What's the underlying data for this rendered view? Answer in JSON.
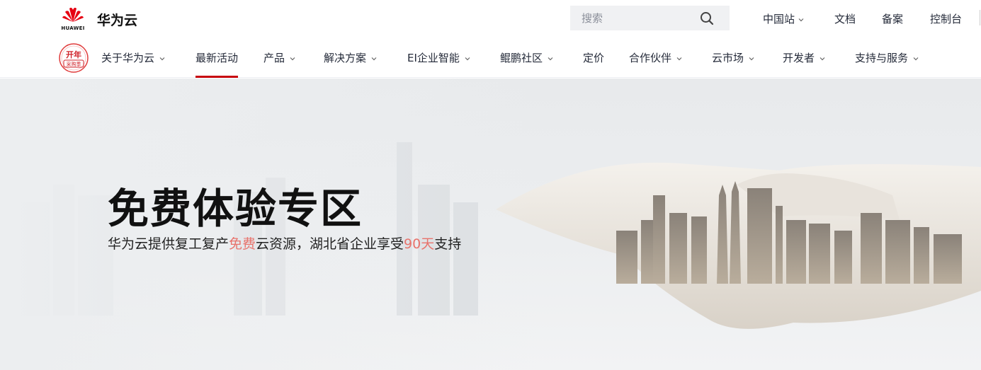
{
  "header": {
    "logo_text": "HUAWEI",
    "brand": "华为云",
    "search": {
      "placeholder": "搜索"
    },
    "links": [
      "中国站",
      "文档",
      "备案",
      "控制台"
    ]
  },
  "nav": {
    "promo_badge": {
      "line1": "开年",
      "line2": "采购季"
    },
    "items": [
      {
        "label": "关于华为云",
        "has_menu": true
      },
      {
        "label": "最新活动",
        "has_menu": false,
        "active": true
      },
      {
        "label": "产品",
        "has_menu": true
      },
      {
        "label": "解决方案",
        "has_menu": true
      },
      {
        "label": "EI企业智能",
        "has_menu": true
      },
      {
        "label": "鲲鹏社区",
        "has_menu": true
      },
      {
        "label": "定价",
        "has_menu": false
      },
      {
        "label": "合作伙伴",
        "has_menu": true
      },
      {
        "label": "云市场",
        "has_menu": true
      },
      {
        "label": "开发者",
        "has_menu": true
      },
      {
        "label": "支持与服务",
        "has_menu": true
      }
    ]
  },
  "hero": {
    "title": "免费体验专区",
    "subtitle_parts": [
      "华为云提供复工复产",
      "免费",
      "云资源，湖北省企业享受",
      "90天",
      "支持"
    ]
  },
  "colors": {
    "accent": "#c7000b",
    "highlight": "#e8736c",
    "search_bg": "#f0f1f3"
  },
  "icons": {
    "search": "search-icon",
    "chevron": "chevron-down-icon",
    "logo": "huawei-logo-icon",
    "hero_art": "handshake-city-illustration"
  }
}
